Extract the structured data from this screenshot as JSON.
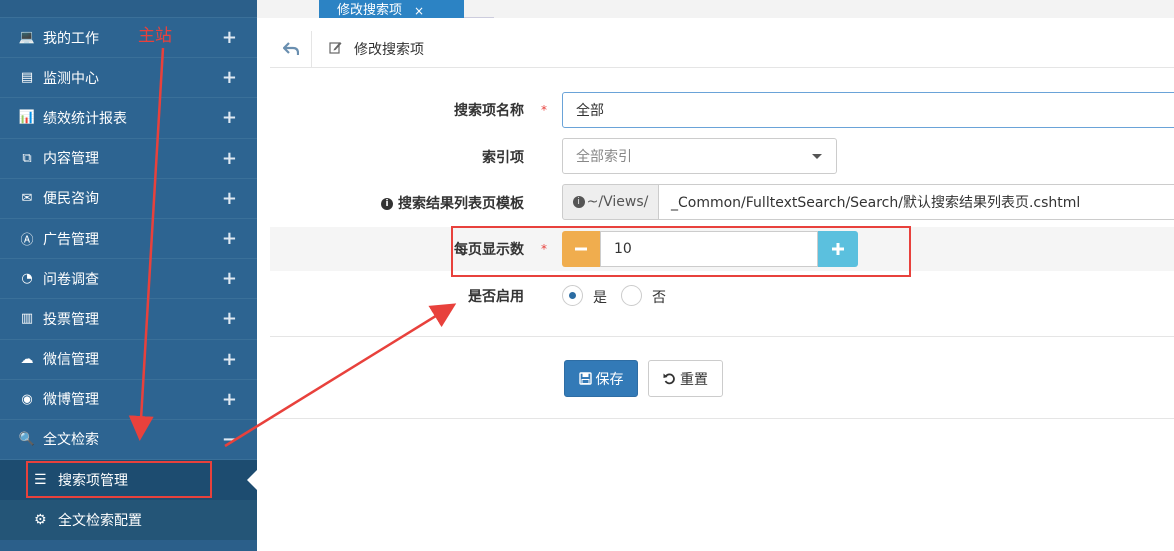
{
  "sidebar": {
    "items": [
      {
        "label": "我的工作",
        "icon": "laptop-icon",
        "glyph": "💻",
        "toggle": "+"
      },
      {
        "label": "监测中心",
        "icon": "monitor-icon",
        "glyph": "▤",
        "toggle": "+"
      },
      {
        "label": "绩效统计报表",
        "icon": "bar-chart-icon",
        "glyph": "📊",
        "toggle": "+"
      },
      {
        "label": "内容管理",
        "icon": "copy-icon",
        "glyph": "⧉",
        "toggle": "+"
      },
      {
        "label": "便民咨询",
        "icon": "envelope-icon",
        "glyph": "✉",
        "toggle": "+"
      },
      {
        "label": "广告管理",
        "icon": "ad-icon",
        "glyph": "Ⓐ",
        "toggle": "+"
      },
      {
        "label": "问卷调查",
        "icon": "pie-chart-icon",
        "glyph": "◔",
        "toggle": "+"
      },
      {
        "label": "投票管理",
        "icon": "chart-icon",
        "glyph": "▥",
        "toggle": "+"
      },
      {
        "label": "微信管理",
        "icon": "wechat-icon",
        "glyph": "☁",
        "toggle": "+"
      },
      {
        "label": "微博管理",
        "icon": "weibo-icon",
        "glyph": "◉",
        "toggle": "+"
      },
      {
        "label": "全文检索",
        "icon": "search-icon",
        "glyph": "🔍",
        "toggle": "−"
      }
    ],
    "subitems": [
      {
        "label": "搜索项管理",
        "icon": "list-icon",
        "glyph": "☰"
      },
      {
        "label": "全文检索配置",
        "icon": "gear-icon",
        "glyph": "⚙"
      }
    ]
  },
  "annotation": {
    "main_site": "主站"
  },
  "tabs": [
    {
      "label": "修改搜索项",
      "close": "×"
    }
  ],
  "breadcrumb": {
    "title": "修改搜索项"
  },
  "form": {
    "name_label": "搜索项名称",
    "name_value": "全部",
    "required_mark": "*",
    "index_label": "索引项",
    "index_value": "全部索引",
    "template_label": "搜索结果列表页模板",
    "template_addon": "~/Views/",
    "template_value": "_Common/FulltextSearch/Search/默认搜索结果列表页.cshtml",
    "page_size_label": "每页显示数",
    "page_size_value": "10",
    "enabled_label": "是否启用",
    "enabled_yes": "是",
    "enabled_no": "否",
    "enabled_selected": "是",
    "save_label": "保存",
    "reset_label": "重置"
  },
  "colors": {
    "sidebar": "#2b5f8a",
    "primary": "#337ab7",
    "warning": "#f0ad4e",
    "info": "#5bc0de",
    "annotation": "#e8413c"
  }
}
